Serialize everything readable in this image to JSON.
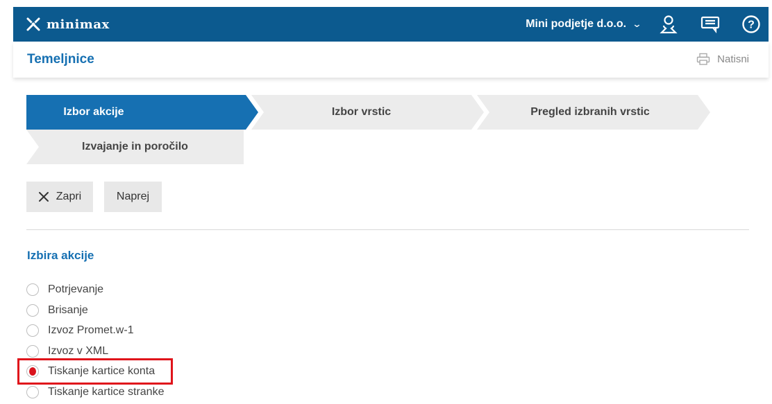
{
  "app": {
    "logo_text": "minimax",
    "company": "Mini podjetje d.o.o.",
    "icons": [
      "user-icon",
      "messages-icon",
      "help-icon"
    ]
  },
  "page": {
    "title": "Temeljnice",
    "print_label": "Natisni"
  },
  "wizard": {
    "steps": [
      {
        "label": "Izbor akcije",
        "active": true
      },
      {
        "label": "Izbor vrstic",
        "active": false
      },
      {
        "label": "Pregled izbranih vrstic",
        "active": false
      },
      {
        "label": "Izvajanje in poročilo",
        "active": false
      }
    ]
  },
  "toolbar": {
    "close_label": "Zapri",
    "next_label": "Naprej"
  },
  "actions": {
    "title": "Izbira akcije",
    "options": [
      {
        "label": "Potrjevanje",
        "selected": false
      },
      {
        "label": "Brisanje",
        "selected": false
      },
      {
        "label": "Izvoz Promet.w-1",
        "selected": false
      },
      {
        "label": "Izvoz v XML",
        "selected": false
      },
      {
        "label": "Tiskanje kartice konta",
        "selected": true
      },
      {
        "label": "Tiskanje kartice stranke",
        "selected": false
      }
    ]
  },
  "colors": {
    "brand": "#0c5a8f",
    "accent": "#1670b2",
    "step_active": "#1670b2",
    "step_inactive": "#ececec",
    "highlight": "#e0141b"
  }
}
